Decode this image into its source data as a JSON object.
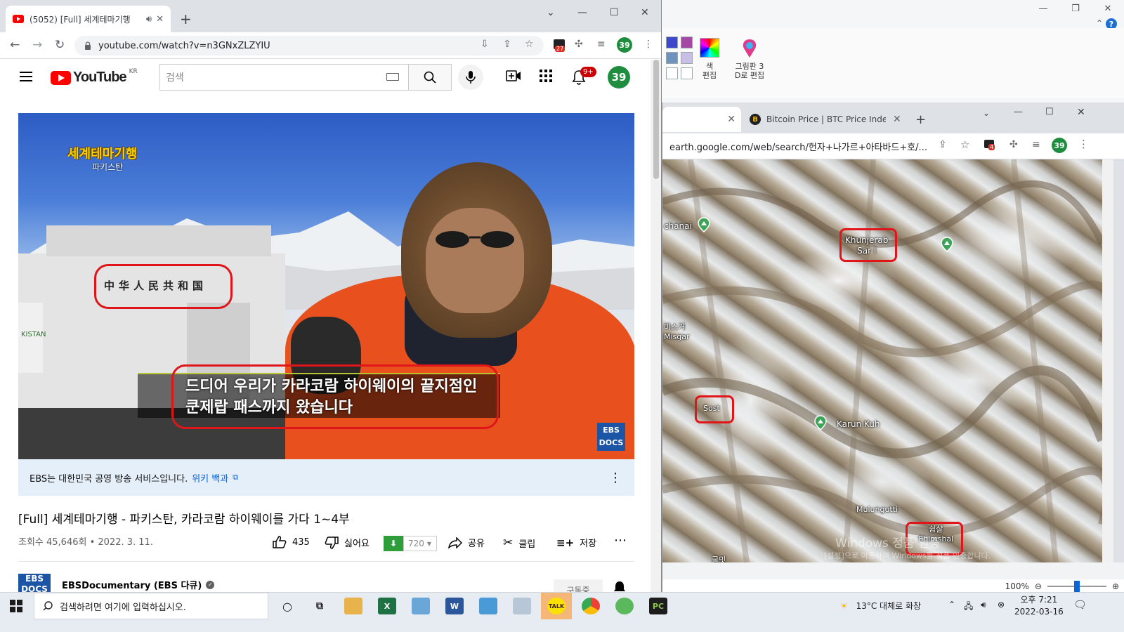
{
  "youtube_window": {
    "tab_title": "(5052) [Full] 세계테마기행",
    "url": "youtube.com/watch?v=n3GNxZLZYIU",
    "extension_badge": "27",
    "profile_initials": "39",
    "yt_logo_text": "YouTube",
    "yt_region": "KR",
    "search_placeholder": "검색",
    "notification_badge": "9+",
    "video": {
      "show_title": "세계테마기행",
      "show_subtitle": "파키스탄",
      "gate_sign": "中华人民共和国",
      "plaque_text": "KISTAN",
      "caption_line1": "드디어 우리가 카라코람 하이웨이의 끝지점인",
      "caption_line2": "쿤제랍 패스까지 왔습니다",
      "watermark_line1": "EBS",
      "watermark_line2": "DOCS"
    },
    "info_panel": {
      "text": "EBS는 대한민국 공영 방송 서비스입니다.",
      "link": "위키 백과"
    },
    "title": "[Full] 세계테마기행 - 파키스탄, 카라코람 하이웨이를 가다 1~4부",
    "meta": "조회수 45,646회 • 2022. 3. 11.",
    "actions": {
      "like_count": "435",
      "dislike_label": "싫어요",
      "download_count": "720",
      "share_label": "공유",
      "clip_label": "클립",
      "save_label": "저장"
    },
    "channel": {
      "logo_line1": "EBS",
      "logo_line2": "DOCS",
      "name": "EBSDocumentary (EBS 다큐)",
      "subscribe_label": "구독중"
    }
  },
  "earth_window": {
    "tab_active_title": "",
    "tab2_title": "Bitcoin Price | BTC Price Index a",
    "url": "earth.google.com/web/search/헌자+나가르+아타바드+호/...",
    "extension_badge": "4",
    "profile_initials": "39",
    "map_labels": {
      "chanai": "chanai",
      "misgar_ko": "미스거",
      "misgar": "Misgar",
      "khunjerab_line1": "Khunjerab",
      "khunjerab_line2": "Sar l",
      "sost": "Sost",
      "karun_kuh": "Karun Kuh",
      "mulungutti": "Mulungutti",
      "shimshal_ko": "쉼샬",
      "shimshal": "Shimshal",
      "gulmit": "굴밋",
      "windows_watermark": "Windows 정품 인증",
      "windows_watermark_sub": "[설정]으로 이동하여 Windows를 정품 인증합니다."
    },
    "zoom_level": "100%"
  },
  "paint_window": {
    "edit_colors_label_line1": "색",
    "edit_colors_label_line2": "편집",
    "paint3d_label_line1": "그림판 3",
    "paint3d_label_line2": "D로 편집",
    "help_glyph": "?"
  },
  "taskbar": {
    "search_placeholder": "검색하려면 여기에 입력하십시오.",
    "weather": "13°C  대체로 화창",
    "time": "오후 7:21",
    "date": "2022-03-16",
    "kakao_label": "TALK",
    "pc_label": "PC"
  },
  "colors": {
    "youtube_red": "#ff0000",
    "annotation_red": "#e0151a",
    "link_blue": "#065fd4",
    "profile_green": "#1e8e3e"
  }
}
